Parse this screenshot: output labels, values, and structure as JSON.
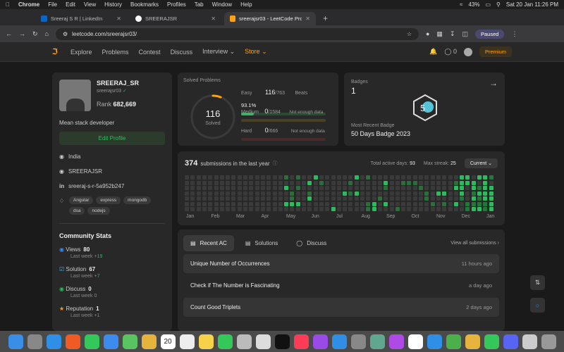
{
  "menubar": {
    "app": "Chrome",
    "items": [
      "File",
      "Edit",
      "View",
      "History",
      "Bookmarks",
      "Profiles",
      "Tab",
      "Window",
      "Help"
    ],
    "battery": "43%",
    "datetime": "Sat 20 Jan  11:26 PM"
  },
  "tabs": [
    {
      "label": "Sreeraj S R | LinkedIn",
      "color": "#0a66c2"
    },
    {
      "label": "SREERAJSR",
      "color": "#ffffff"
    },
    {
      "label": "sreerajsr03 - LeetCode Profile",
      "color": "#ffa116"
    }
  ],
  "address": {
    "url": "leetcode.com/sreerajsr03/",
    "profile_label": "Paused"
  },
  "nav": {
    "items": [
      "Explore",
      "Problems",
      "Contest",
      "Discuss",
      "Interview"
    ],
    "store": "Store",
    "coins": "0",
    "premium": "Premium"
  },
  "profile": {
    "name": "SREERAJ_SR",
    "handle": "sreerajsr03",
    "rank_label": "Rank",
    "rank_value": "682,669",
    "bio": "Mean stack developer",
    "edit": "Edit Profile",
    "location": "India",
    "github": "SREERAJSR",
    "linkedin": "sreeraj-s-r-5a952b247",
    "skills": [
      "Angular",
      "express",
      "mongodb",
      "dsa",
      "nodejs"
    ]
  },
  "community": {
    "title": "Community Stats",
    "stats": [
      {
        "label": "Views",
        "value": "80",
        "last_week": "Last week",
        "delta": "+19",
        "icon_color": "#3c8cf0"
      },
      {
        "label": "Solution",
        "value": "67",
        "last_week": "Last week",
        "delta": "+7",
        "icon_color": "#46b5e6"
      },
      {
        "label": "Discuss",
        "value": "0",
        "last_week": "Last week",
        "delta": "0",
        "icon_color": "#2cbb5d"
      },
      {
        "label": "Reputation",
        "value": "1",
        "last_week": "Last week",
        "delta": "+1",
        "icon_color": "#ffa116"
      }
    ]
  },
  "solved": {
    "title": "Solved Problems",
    "count": "116",
    "count_label": "Solved",
    "progress": 0.06,
    "easy": {
      "label": "Easy",
      "value": "116",
      "total": "/763",
      "beats_label": "Beats",
      "beats": "93.1%",
      "fraction": 0.152,
      "color": "#2cbb5d"
    },
    "medium": {
      "label": "Medium",
      "value": "0",
      "total": "/1584",
      "note": "Not enough data",
      "fraction": 0,
      "color": "#ffc01e"
    },
    "hard": {
      "label": "Hard",
      "value": "0",
      "total": "/666",
      "note": "Not enough data",
      "fraction": 0,
      "color": "#ef4743"
    }
  },
  "badges": {
    "title": "Badges",
    "count": "1",
    "recent_label": "Most Recent Badge",
    "recent": "50 Days Badge 2023"
  },
  "submissions": {
    "count": "374",
    "label": "submissions in the last year",
    "active_label": "Total active days:",
    "active": "93",
    "streak_label": "Max streak:",
    "streak": "25",
    "select": "Current",
    "months": [
      "Jan",
      "Feb",
      "Mar",
      "Apr",
      "May",
      "Jun",
      "Jul",
      "Aug",
      "Sep",
      "Oct",
      "Nov",
      "Dec",
      "Jan"
    ]
  },
  "recent": {
    "tabs": [
      "Recent AC",
      "Solutions",
      "Discuss"
    ],
    "view_all": "View all submissions",
    "rows": [
      {
        "title": "Unique Number of Occurrences",
        "time": "11 hours ago"
      },
      {
        "title": "Check if The Number is Fascinating",
        "time": "a day ago"
      },
      {
        "title": "Count Good Triplets",
        "time": "2 days ago"
      }
    ]
  },
  "dock": {
    "calendar_day": "20"
  }
}
